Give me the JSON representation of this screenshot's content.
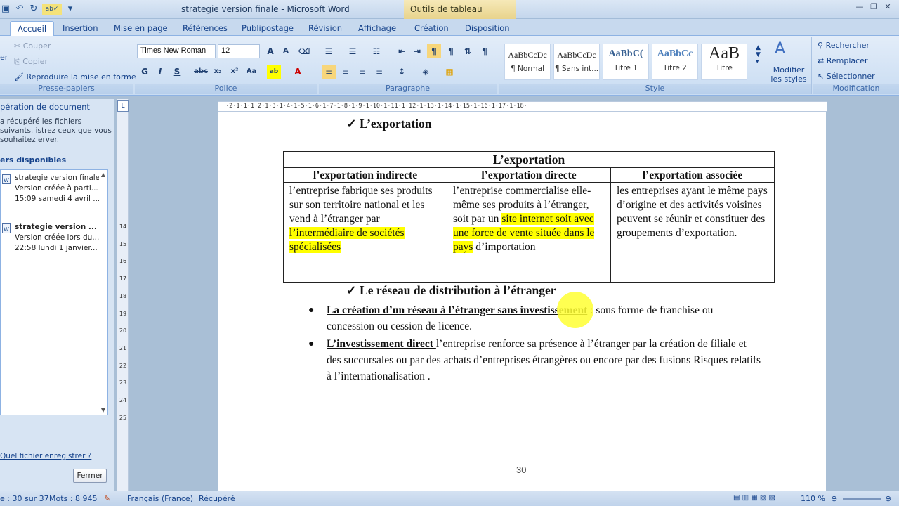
{
  "window": {
    "title": "strategie version finale - Microsoft Word",
    "context_tab": "Outils de tableau"
  },
  "tabs": [
    "Accueil",
    "Insertion",
    "Mise en page",
    "Références",
    "Publipostage",
    "Révision",
    "Affichage",
    "Création",
    "Disposition"
  ],
  "ribbon": {
    "clipboard": {
      "cut": "Couper",
      "copy": "Copier",
      "format_painter": "Reproduire la mise en forme",
      "label": "Presse-papiers",
      "paste_partial": "er"
    },
    "font": {
      "name": "Times New Roman",
      "size": "12",
      "label": "Police"
    },
    "paragraph": {
      "label": "Paragraphe"
    },
    "styles": {
      "items": [
        {
          "preview": "AaBbCcDc",
          "name": "¶ Normal"
        },
        {
          "preview": "AaBbCcDc",
          "name": "¶ Sans int..."
        },
        {
          "preview": "AaBbC(",
          "name": "Titre 1"
        },
        {
          "preview": "AaBbCc",
          "name": "Titre 2"
        },
        {
          "preview": "AaB",
          "name": "Titre"
        }
      ],
      "modify": "Modifier les styles",
      "label": "Style"
    },
    "editing": {
      "find": "Rechercher",
      "replace": "Remplacer",
      "select": "Sélectionner",
      "label": "Modification"
    }
  },
  "recovery": {
    "title": "pération de document",
    "desc": "a récupéré les fichiers suivants. istrez ceux que vous souhaitez erver.",
    "heading": "ers disponibles",
    "files": [
      {
        "name": "strategie version finale",
        "line1": "Version créée à parti...",
        "line2": "15:09 samedi 4 avril ..."
      },
      {
        "name": "strategie version ...",
        "line1": "Version créée lors du...",
        "line2": "22:58 lundi 1 janvier..."
      }
    ],
    "question": "Quel fichier enregistrer ?",
    "close": "Fermer"
  },
  "document": {
    "heading1": "✓  L’exportation",
    "table": {
      "title": "L’exportation",
      "headers": [
        "l’exportation indirecte",
        "l’exportation directe",
        "l’exportation associée"
      ],
      "col1_plain": "l’entreprise fabrique ses produits sur son territoire national et les vend à l’étranger  par ",
      "col1_hl": "l’intermédiaire de sociétés spécialisées",
      "col2_plain": "l’entreprise commercialise elle-même ses produits à l’étranger, soit par un ",
      "col2_hl": "site internet soit avec une force de vente située dans le pays",
      "col2_tail": " d’importation",
      "col3": "les entreprises ayant le même pays d’origine et des activités voisines peuvent se réunir et constituer des groupements d’exportation."
    },
    "heading2": "✓  Le réseau de distribution  à l’étranger",
    "bullet1_title": "La création d’un réseau à l’étranger sans investissement",
    "bullet1_text": " : sous forme de franchise ou concession ou cession de licence.",
    "bullet2_title": "L’investissement direct ",
    "bullet2_text": "l’entreprise renforce sa présence à l’étranger par la création de filiale et des succursales ou par des achats d’entreprises étrangères ou encore par des fusions Risques  relatifs à l’internationalisation .",
    "page_number": "30"
  },
  "status": {
    "page": "e : 30 sur 37",
    "words": "Mots : 8 945",
    "language": "Français (France)",
    "state": "Récupéré",
    "zoom": "110 %"
  },
  "ruler": {
    "h": "·2·1·1·1·2·1·3·1·4·1·5·1·6·1·7·1·8·1·9·1·10·1·11·1·12·1·13·1·14·1·15·1·16·1·17·1·18·",
    "v": [
      "14",
      "15",
      "16",
      "17",
      "18",
      "19",
      "20",
      "21",
      "22",
      "23",
      "24",
      "25"
    ]
  }
}
